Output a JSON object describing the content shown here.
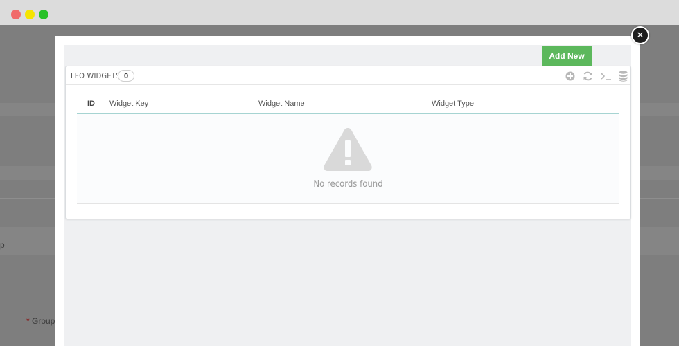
{
  "window": {
    "controls": [
      "close",
      "minimize",
      "maximize"
    ]
  },
  "background": {
    "field_label": "Group",
    "required_mark": "*",
    "row_fragment": "p"
  },
  "modal": {
    "close_icon": "close-icon",
    "add_new_label": "Add New",
    "panel": {
      "title": "LEO WIDGETS",
      "count": "0",
      "tools": [
        "add-icon",
        "refresh-icon",
        "terminal-icon",
        "database-icon"
      ]
    },
    "table": {
      "columns": [
        "ID",
        "Widget Key",
        "Widget Name",
        "Widget Type"
      ],
      "rows": []
    },
    "empty": {
      "icon": "warning-icon",
      "text": "No records found"
    }
  },
  "colors": {
    "add_new": "#5cb85c",
    "header_border": "#a6d4d2",
    "overlay": "#7e7e7e"
  }
}
